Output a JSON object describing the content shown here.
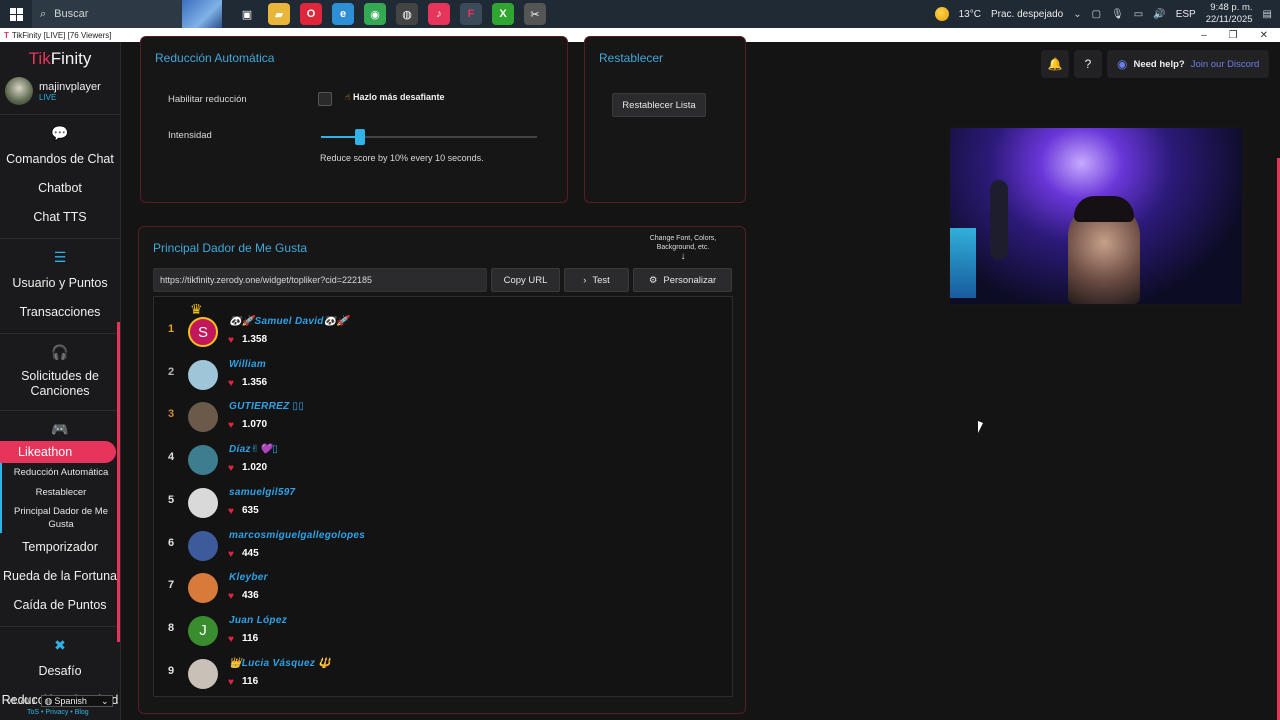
{
  "taskbar": {
    "search_placeholder": "Buscar",
    "apps": [
      {
        "name": "task-view-icon",
        "glyph": "▣"
      },
      {
        "name": "file-explorer-icon",
        "glyph": "▰",
        "color": "#e9b63a"
      },
      {
        "name": "opera-icon",
        "glyph": "O",
        "color": "#e0263a"
      },
      {
        "name": "edge-icon",
        "glyph": "e",
        "color": "#2d8fd6"
      },
      {
        "name": "chrome-icon",
        "glyph": "◉",
        "color": "#34a853"
      },
      {
        "name": "obs-icon",
        "glyph": "◍",
        "color": "#444"
      },
      {
        "name": "tiktok-icon",
        "glyph": "♪",
        "color": "#e6345a"
      },
      {
        "name": "tikfinity-icon",
        "glyph": "F",
        "color": "#e6345a"
      },
      {
        "name": "xbox-icon",
        "glyph": "X",
        "color": "#2fa62f"
      },
      {
        "name": "capcut-icon",
        "glyph": "✂",
        "color": "#555"
      }
    ],
    "weather_temp": "13°C",
    "weather_text": "Prac. despejado",
    "lang": "ESP",
    "time": "9:48 p. m.",
    "date": "22/11/2025"
  },
  "window": {
    "title": "TikFinity [LIVE] [76 Viewers]"
  },
  "sidebar": {
    "brand_tik": "Tik",
    "brand_finity": "Finity",
    "username": "majinvplayer",
    "status": "LIVE",
    "items_a": [
      "Comandos de Chat",
      "Chatbot",
      "Chat TTS"
    ],
    "items_b": [
      "Usuario y Puntos",
      "Transacciones"
    ],
    "items_c": [
      "Solicitudes de Canciones"
    ],
    "active": "Likeathon",
    "subitems": [
      "Reducción Automática",
      "Restablecer",
      "Principal Dador de Me Gusta"
    ],
    "items_d": [
      "Temporizador",
      "Rueda de la Fortuna",
      "Caída de Puntos"
    ],
    "items_e": [
      "Desafío",
      "Reducción a la Mitad"
    ],
    "version": "v1.70.1",
    "language": "Spanish",
    "links": "ToS • Privacy • Blog"
  },
  "auto_reduction": {
    "title": "Reducción Automática",
    "enable_label": "Habilitar reducción",
    "challenge_hint": "Hazlo más desafiante",
    "intensity_label": "Intensidad",
    "intensity_value": 0.18,
    "description": "Reduce score by 10% every 10 seconds."
  },
  "reset": {
    "title": "Restablecer",
    "button": "Restablecer Lista"
  },
  "top_liker": {
    "title": "Principal Dador de Me Gusta",
    "note": "Change Font, Colors, Background, etc.",
    "url": "https://tikfinity.zerody.one/widget/topliker?cid=222185",
    "copy_button": "Copy URL",
    "test_button": "Test",
    "customize_button": "Personalizar",
    "entries": [
      {
        "rank": "1",
        "name": "🐼🚀Samuel David🐼🚀",
        "count": "1.358",
        "initial": "S",
        "bg": "#c2185b"
      },
      {
        "rank": "2",
        "name": "William",
        "count": "1.356",
        "initial": "",
        "bg": "#9fc6d8"
      },
      {
        "rank": "3",
        "name": "GUTIERREZ ▯▯",
        "count": "1.070",
        "initial": "",
        "bg": "#6b5a4a"
      },
      {
        "rank": "4",
        "name": "Díaz✌💜▯",
        "count": "1.020",
        "initial": "",
        "bg": "#3e7d8f"
      },
      {
        "rank": "5",
        "name": "samuelgil597",
        "count": "635",
        "initial": "",
        "bg": "#d9d9d9"
      },
      {
        "rank": "6",
        "name": "marcosmiguelgallegolopes",
        "count": "445",
        "initial": "",
        "bg": "#3d5a9a"
      },
      {
        "rank": "7",
        "name": "Kleyber",
        "count": "436",
        "initial": "",
        "bg": "#d77a3a"
      },
      {
        "rank": "8",
        "name": "Juan López",
        "count": "116",
        "initial": "J",
        "bg": "#3a8d2f"
      },
      {
        "rank": "9",
        "name": "👑Lucia Vásquez 🔱",
        "count": "116",
        "initial": "",
        "bg": "#c9c0b8"
      }
    ]
  },
  "header": {
    "need_help": "Need help?",
    "join_discord": "Join our Discord"
  }
}
